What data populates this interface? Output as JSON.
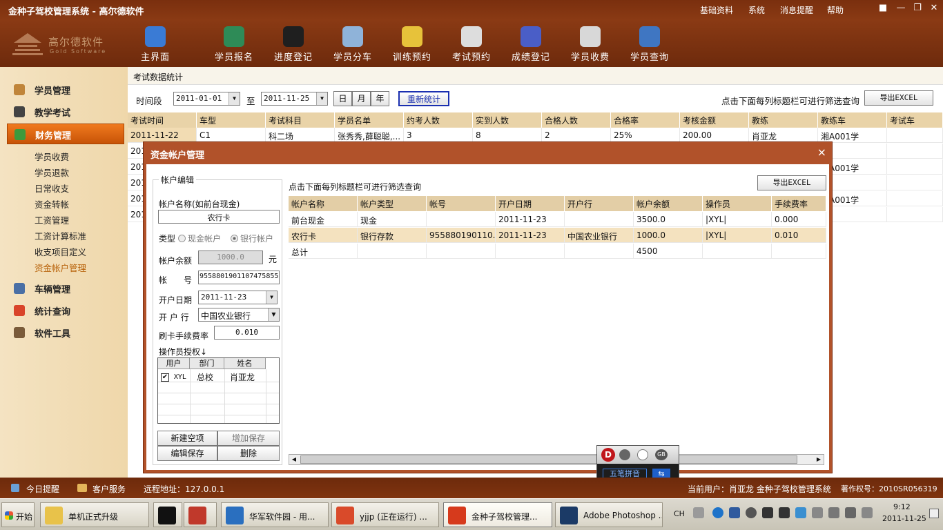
{
  "app": {
    "title": "金种子驾校管理系统  -  高尔德软件",
    "menu": [
      "基础资料",
      "系统",
      "消息提醒",
      "帮助"
    ],
    "logo_cn": "高尔德软件",
    "logo_en": "Gold Software"
  },
  "toolbar": [
    {
      "label": "主界面",
      "icon": "home-icon",
      "color": "#3a7bd5"
    },
    {
      "label": "学员报名",
      "icon": "student-register-icon",
      "color": "#2e8b57"
    },
    {
      "label": "进度登记",
      "icon": "progress-icon",
      "color": "#1f1f1f"
    },
    {
      "label": "学员分车",
      "icon": "car-assign-icon",
      "color": "#8fb3d9"
    },
    {
      "label": "训练预约",
      "icon": "clock-icon",
      "color": "#e7c23a"
    },
    {
      "label": "考试预约",
      "icon": "exam-icon",
      "color": "#dddddd"
    },
    {
      "label": "成绩登记",
      "icon": "chart-icon",
      "color": "#4a5ec7"
    },
    {
      "label": "学员收费",
      "icon": "money-bag-icon",
      "color": "#d8d8d8"
    },
    {
      "label": "学员查询",
      "icon": "user-search-icon",
      "color": "#3f76c2"
    }
  ],
  "sidebar": {
    "sections": [
      {
        "label": "学员管理",
        "icon": "users-icon",
        "color": "#c0853a"
      },
      {
        "label": "教学考试",
        "icon": "hat-icon",
        "color": "#444444"
      },
      {
        "label": "财务管理",
        "icon": "finance-icon",
        "color": "#3c9a3c",
        "active": true
      },
      {
        "label": "车辆管理",
        "icon": "car-icon",
        "color": "#4a6fa5"
      },
      {
        "label": "统计查询",
        "icon": "bar-chart-icon",
        "color": "#d9442a"
      },
      {
        "label": "软件工具",
        "icon": "tools-icon",
        "color": "#7a5b3a"
      }
    ],
    "finance_items": [
      "学员收费",
      "学员退款",
      "日常收支",
      "资金转帐",
      "工资管理",
      "工资计算标准",
      "收支项目定义",
      "资金帐户管理"
    ],
    "current_item": "资金帐户管理"
  },
  "main": {
    "title": "考试数据统计",
    "period_label": "时间段",
    "date_from": "2011-01-01",
    "to_label": "至",
    "date_to": "2011-11-25",
    "unit_buttons": [
      "日",
      "月",
      "年"
    ],
    "recount_button": "重新统计",
    "hint": "点击下面每列标题栏可进行筛选查询",
    "export_button": "导出EXCEL",
    "columns": [
      "考试时间",
      "车型",
      "考试科目",
      "学员名单",
      "约考人数",
      "实到人数",
      "合格人数",
      "合格率",
      "考核金额",
      "教练",
      "教练车",
      "考试车"
    ],
    "first_row": [
      "2011-11-22",
      "C1",
      "科二场",
      "张秀秀,薛聪聪,...",
      "3",
      "8",
      "2",
      "25%",
      "200.00",
      "肖亚龙",
      "湘A001学",
      ""
    ],
    "row_prefix": "201",
    "row_tails": [
      "",
      "湘A001学",
      "",
      "湘A001学",
      ""
    ]
  },
  "dialog": {
    "title": "资金帐户管理",
    "close": "×",
    "edit_group": "帐户编辑",
    "name_label": "帐户名称(如前台现金)",
    "name_value": "农行卡",
    "type_label": "类型",
    "type_cash": "现金帐户",
    "type_bank": "银行帐户",
    "balance_label": "帐户余额",
    "balance_value": "1000.0",
    "balance_unit": "元",
    "account_label": "帐　　号",
    "account_value": "9558801901107475855",
    "open_date_label": "开户日期",
    "open_date_value": "2011-11-23",
    "bank_label": "开 户 行",
    "bank_value": "中国农业银行",
    "fee_label": "刷卡手续费率",
    "fee_value": "0.010",
    "operator_label": "操作员授权↓",
    "op_columns": [
      "用户",
      "部门",
      "姓名"
    ],
    "op_rows": [
      {
        "user": "XYL",
        "dept": "总校",
        "name": "肖亚龙",
        "checked": true
      }
    ],
    "buttons": {
      "new": "新建空项",
      "add_save": "增加保存",
      "edit_save": "编辑保存",
      "delete": "删除"
    },
    "hint": "点击下面每列标题栏可进行筛选查询",
    "export_button": "导出EXCEL",
    "columns": [
      "帐户名称",
      "帐户类型",
      "帐号",
      "开户日期",
      "开户行",
      "帐户余额",
      "操作员",
      "手续费率"
    ],
    "rows": [
      [
        "前台现金",
        "现金",
        "",
        "2011-11-23",
        "",
        "3500.0",
        "|XYL|",
        "0.000"
      ],
      [
        "农行卡",
        "银行存款",
        "955880190110...",
        "2011-11-23",
        "中国农业银行",
        "1000.0",
        "|XYL|",
        "0.010"
      ],
      [
        "总计",
        "",
        "",
        "",
        "",
        "4500",
        "",
        ""
      ]
    ]
  },
  "statusbar": {
    "reminder": "今日提醒",
    "service": "客户服务",
    "remote": "远程地址：127.0.0.1",
    "user": "当前用户：肖亚龙 金种子驾校管理系统",
    "copyright": "著作权号：2010SR056319"
  },
  "ime": {
    "mode": "五笔拼音",
    "gb": "GB"
  },
  "taskbar": {
    "start": "开始",
    "tasks": [
      {
        "label": "单机正式升级",
        "icon": "folder-icon",
        "color": "#e8c24a"
      },
      {
        "label": "",
        "icon": "terminal-icon",
        "color": "#111111"
      },
      {
        "label": "",
        "icon": "gears-icon",
        "color": "#c0392b"
      },
      {
        "label": "华军软件园 - 用...",
        "icon": "browser-icon",
        "color": "#2a6fbf"
      },
      {
        "label": "yjjp (正在运行) ...",
        "icon": "vs-icon",
        "color": "#d94a2a"
      },
      {
        "label": "金种子驾校管理...",
        "icon": "app-icon",
        "color": "#d63a1c",
        "active": true
      },
      {
        "label": "Adobe Photoshop ...",
        "icon": "photoshop-icon",
        "color": "#1b3a66"
      }
    ],
    "lang": "CH",
    "time": "9:12",
    "date": "2011-11-25"
  }
}
